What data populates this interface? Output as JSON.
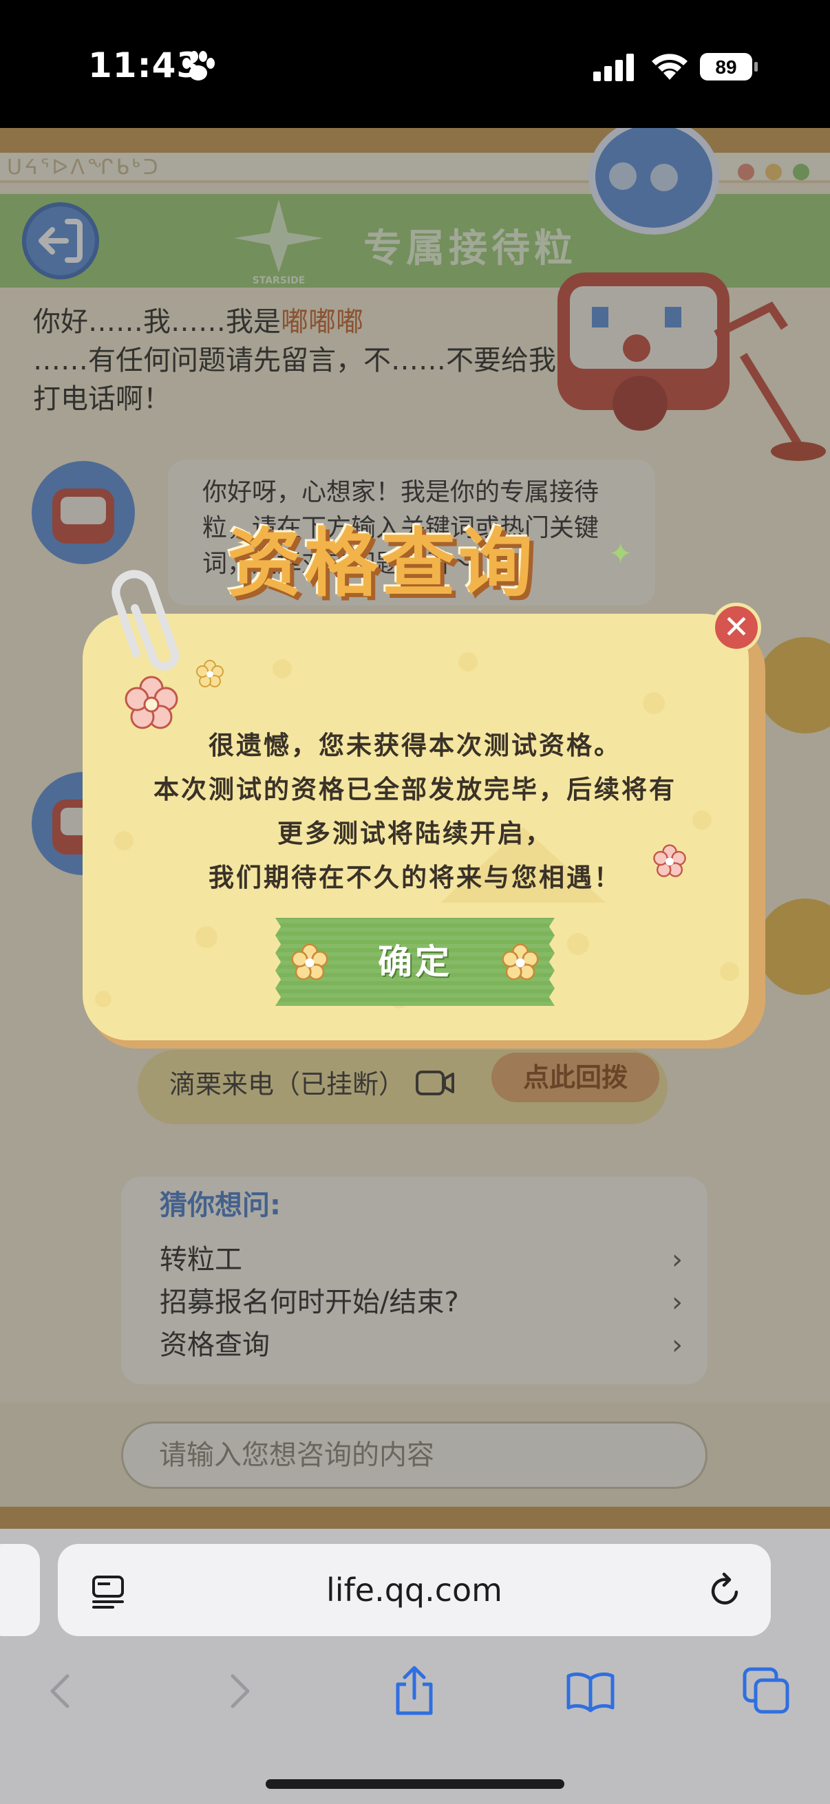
{
  "status_bar": {
    "time": "11:43",
    "battery": "89"
  },
  "header": {
    "title": "专属接待粒",
    "logo_text": "STARSIDE",
    "deco_text": "ᑌᔦᕐᐅᐱᖏᑲᒃᑐ"
  },
  "greeting": {
    "line_prefix": "你好……我……我是",
    "name": "嘟嘟嘟",
    "line_rest": "……有任何问题请先留言，不……不要给我打电话啊！"
  },
  "bot_bubble": {
    "text": "你好呀，心想家！我是你的专属接待粒，请在下方输入关键词或热门关键词，选择对应问题查看～"
  },
  "call": {
    "text": "滴栗来电（已挂断）",
    "callback_label": "点此回拨"
  },
  "faq": {
    "title": "猜你想问:",
    "items": [
      {
        "label": "转粒工"
      },
      {
        "label": "招募报名何时开始/结束?"
      },
      {
        "label": "资格查询"
      }
    ]
  },
  "chat_input": {
    "placeholder": "请输入您想咨询的内容"
  },
  "modal": {
    "title": "资格查询",
    "lines": [
      "很遗憾，您未获得本次测试资格。",
      "本次测试的资格已全部发放完毕，后续将有",
      "更多测试将陆续开启，",
      "我们期待在不久的将来与您相遇！"
    ],
    "confirm_label": "确定"
  },
  "browser": {
    "url": "life.qq.com"
  },
  "colors": {
    "header_green": "#9ccb74",
    "modal_yellow": "#f4e6a0",
    "title_orange": "#f2b44a",
    "confirm_green": "#7cb45a",
    "close_red": "#d6554e",
    "faq_blue": "#4a7cc8"
  }
}
